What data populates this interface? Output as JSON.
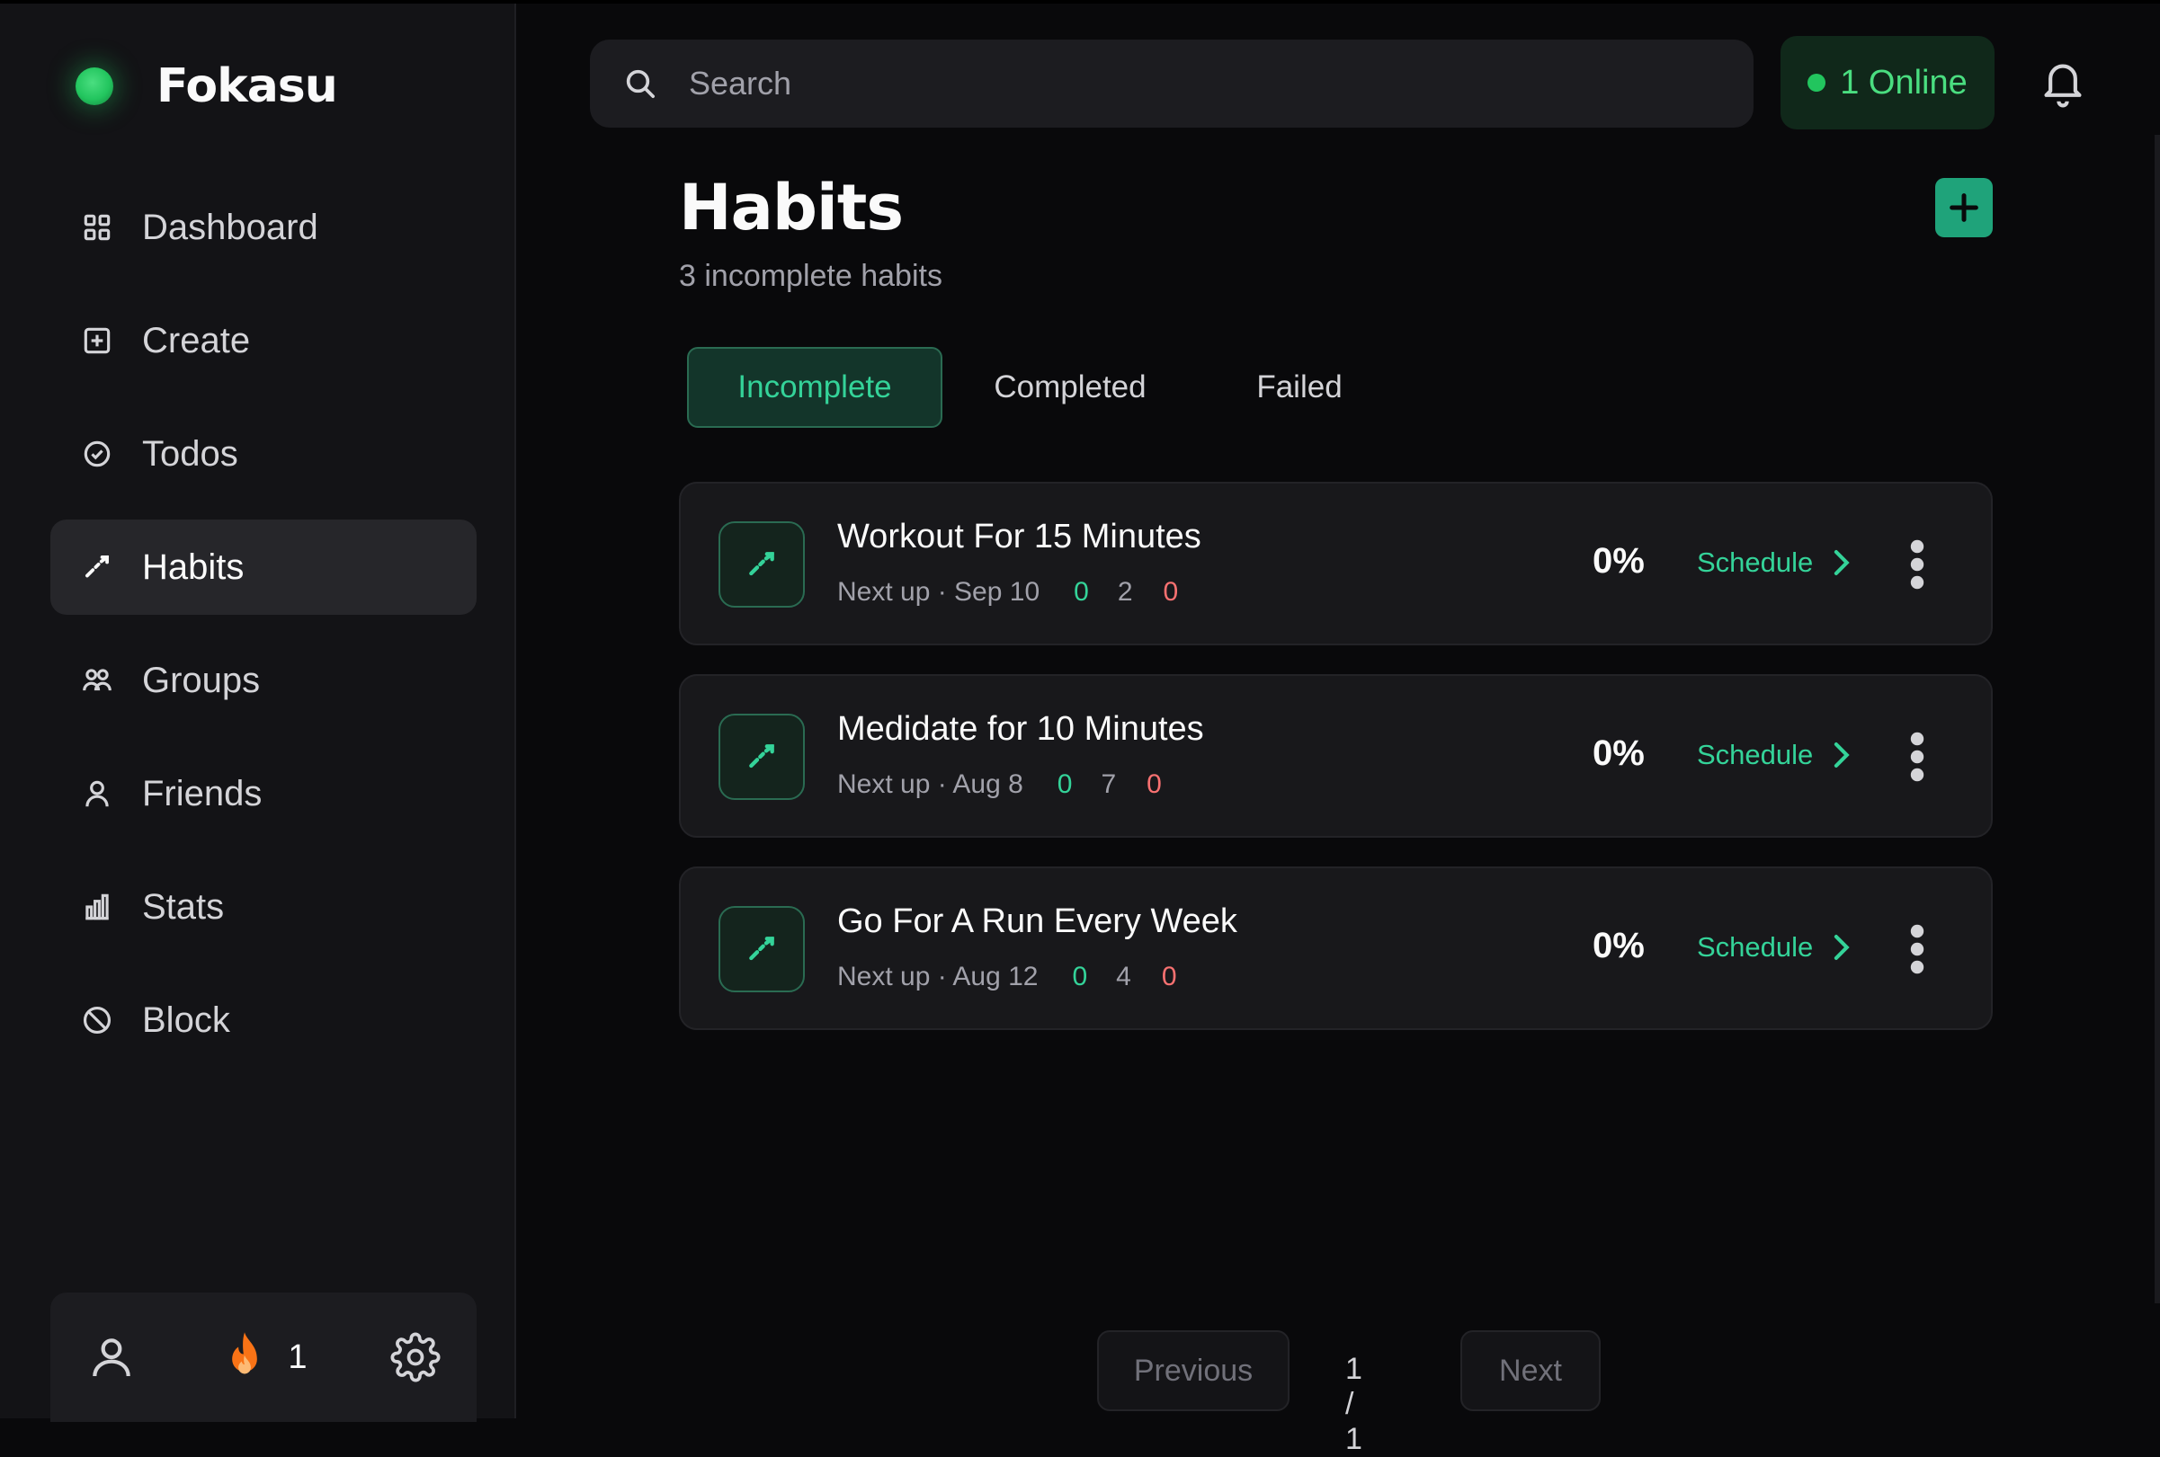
{
  "app": {
    "name": "Fokasu"
  },
  "colors": {
    "accent": "#34d399",
    "brand": "#22c55e",
    "danger": "#f87171",
    "background": "#09090b"
  },
  "sidebar": {
    "items": [
      {
        "label": "Dashboard",
        "icon": "grid-icon",
        "active": false
      },
      {
        "label": "Create",
        "icon": "plus-square-icon",
        "active": false
      },
      {
        "label": "Todos",
        "icon": "check-circle-icon",
        "active": false
      },
      {
        "label": "Habits",
        "icon": "trend-icon",
        "active": true
      },
      {
        "label": "Groups",
        "icon": "users-icon",
        "active": false
      },
      {
        "label": "Friends",
        "icon": "user-icon",
        "active": false
      },
      {
        "label": "Stats",
        "icon": "bar-chart-icon",
        "active": false
      },
      {
        "label": "Block",
        "icon": "ban-icon",
        "active": false
      }
    ],
    "footer": {
      "streak_count": "1"
    }
  },
  "topbar": {
    "search_placeholder": "Search",
    "online_label": "1 Online"
  },
  "main": {
    "title": "Habits",
    "subtitle": "3 incomplete habits",
    "tabs": [
      {
        "label": "Incomplete",
        "active": true
      },
      {
        "label": "Completed",
        "active": false
      },
      {
        "label": "Failed",
        "active": false
      }
    ],
    "habits": [
      {
        "title": "Workout For 15 Minutes",
        "next": "Next up · Sep 10",
        "green": "0",
        "gray": "2",
        "red": "0",
        "percent": "0%",
        "action": "Schedule"
      },
      {
        "title": "Medidate for 10 Minutes",
        "next": "Next up · Aug 8",
        "green": "0",
        "gray": "7",
        "red": "0",
        "percent": "0%",
        "action": "Schedule"
      },
      {
        "title": "Go For A Run Every Week",
        "next": "Next up · Aug 12",
        "green": "0",
        "gray": "4",
        "red": "0",
        "percent": "0%",
        "action": "Schedule"
      }
    ],
    "pagination": {
      "previous": "Previous",
      "page": "1 / 1",
      "next": "Next"
    }
  }
}
